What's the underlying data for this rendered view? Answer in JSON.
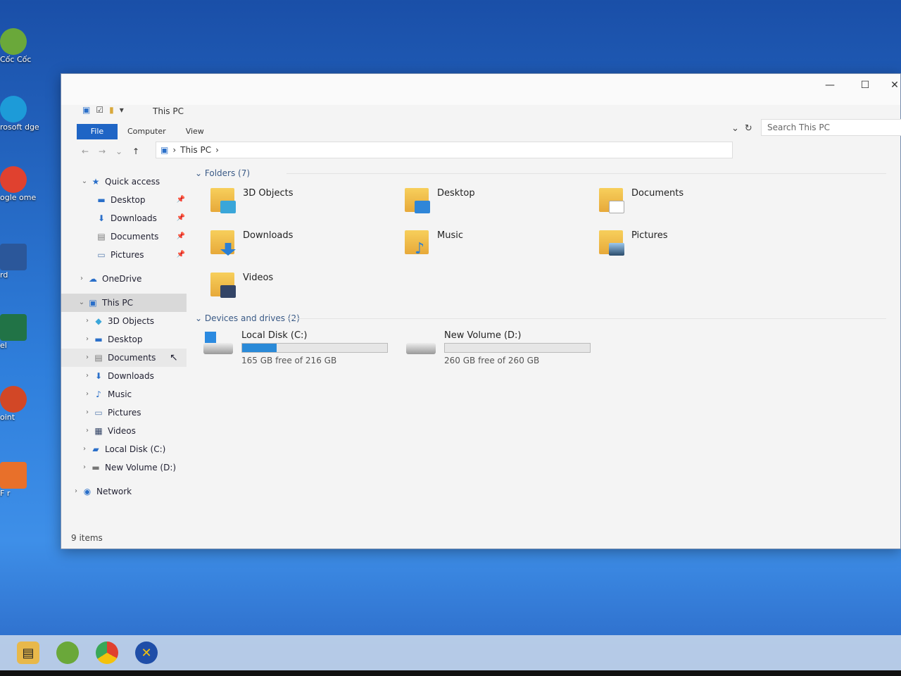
{
  "desktop": {
    "icons": [
      {
        "label": "Cốc Cốc",
        "icon": "coccoc-icon",
        "color": "#6aa83a"
      },
      {
        "label": "rosoft\ndge",
        "icon": "edge-icon",
        "color": "#1d9bd8"
      },
      {
        "label": "ogle\nome",
        "icon": "chrome-icon",
        "color": "#e0412f"
      },
      {
        "label": "rd",
        "icon": "word-icon",
        "color": "#2b579a"
      },
      {
        "label": "el",
        "icon": "excel-icon",
        "color": "#217346"
      },
      {
        "label": "oint",
        "icon": "powerpoint-icon",
        "color": "#d24726"
      },
      {
        "label": "F\nr",
        "icon": "pdf-icon",
        "color": "#e8702a"
      }
    ]
  },
  "window": {
    "title": "This PC",
    "controls": {
      "minimize": "—",
      "maximize": "☐",
      "close": "✕"
    },
    "ribbon": {
      "file": "File",
      "computer": "Computer",
      "view": "View"
    },
    "address": {
      "path_root": "This PC"
    },
    "search": {
      "placeholder": "Search This PC"
    },
    "status": "9 items"
  },
  "nav_pane": {
    "quick_access": "Quick access",
    "quick_items": [
      "Desktop",
      "Downloads",
      "Documents",
      "Pictures"
    ],
    "onedrive": "OneDrive",
    "this_pc": "This PC",
    "pc_items": [
      "3D Objects",
      "Desktop",
      "Documents",
      "Downloads",
      "Music",
      "Pictures",
      "Videos",
      "Local Disk (C:)",
      "New Volume (D:)"
    ],
    "network": "Network"
  },
  "content": {
    "folders_header": "Folders (7)",
    "folders": [
      {
        "name": "3D Objects",
        "overlay": "#3aa6d9"
      },
      {
        "name": "Desktop",
        "overlay": "#2f86d8"
      },
      {
        "name": "Documents",
        "overlay": "#ffffff"
      },
      {
        "name": "Downloads",
        "overlay": "#2b7fd4"
      },
      {
        "name": "Music",
        "overlay": "#2b7fd4"
      },
      {
        "name": "Pictures",
        "overlay": "#5a9ad0"
      },
      {
        "name": "Videos",
        "overlay": "#334466"
      }
    ],
    "drives_header": "Devices and drives (2)",
    "drives": [
      {
        "name": "Local Disk (C:)",
        "free_text": "165 GB free of 216 GB",
        "used_fraction": 0.236,
        "icon": "windows-drive-icon"
      },
      {
        "name": "New Volume (D:)",
        "free_text": "260 GB free of 260 GB",
        "used_fraction": 0.0,
        "icon": "drive-icon"
      }
    ]
  },
  "taskbar": {
    "apps": [
      "file-explorer-icon",
      "coccoc-icon",
      "chrome-icon",
      "xmind-icon"
    ]
  },
  "accent_color": "#1f65c5"
}
